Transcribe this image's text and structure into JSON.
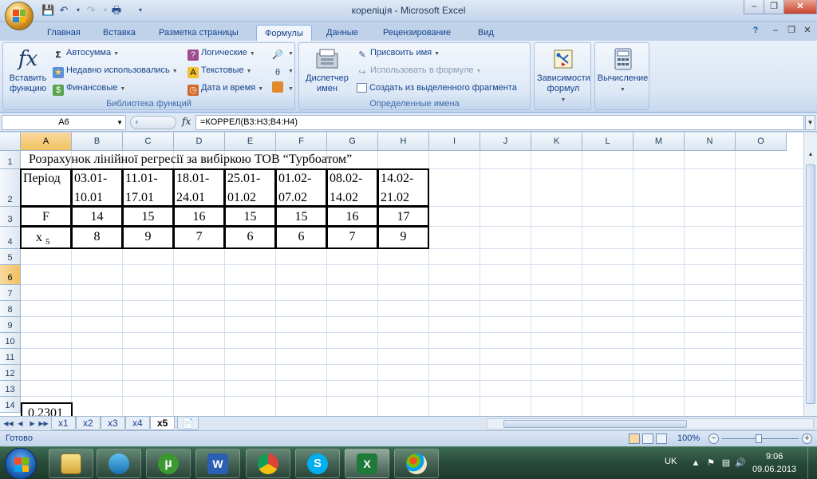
{
  "window": {
    "title": "кореліція - Microsoft Excel",
    "minimize": "–",
    "maximize": "❐",
    "close": "✕"
  },
  "ribbon_tabs": [
    "Главная",
    "Вставка",
    "Разметка страницы",
    "Формулы",
    "Данные",
    "Рецензирование",
    "Вид"
  ],
  "active_tab": "Формулы",
  "ribbon": {
    "function_library": {
      "label": "Библиотека функций",
      "insert_function": "Вставить функцию",
      "autosum": "Автосумма",
      "recently_used": "Недавно использовались",
      "financial": "Финансовые",
      "logical": "Логические",
      "text": "Текстовые",
      "date_time": "Дата и время"
    },
    "defined_names": {
      "label": "Определенные имена",
      "name_manager": "Диспетчер имен",
      "define_name": "Присвоить имя",
      "use_in_formula": "Использовать в формуле",
      "create_from_selection": "Создать из выделенного фрагмента"
    },
    "formula_auditing": {
      "label": "Зависимости формул"
    },
    "calculation": {
      "label": "Вычисление"
    }
  },
  "formula_bar": {
    "name_box": "A6",
    "fx": "fx",
    "formula": "=КОРРЕЛ(B3:H3;B4:H4)"
  },
  "columns": [
    "A",
    "B",
    "C",
    "D",
    "E",
    "F",
    "G",
    "H",
    "I",
    "J",
    "K",
    "L",
    "M",
    "N",
    "O"
  ],
  "rows": [
    "1",
    "2",
    "3",
    "4",
    "5",
    "6",
    "7",
    "8",
    "9",
    "10",
    "11",
    "12",
    "13",
    "14"
  ],
  "selected_cell": {
    "column": "A",
    "row": "6"
  },
  "sheet": {
    "title": "Розрахунок лінійної регресії за вибіркою ТОВ “Турбоатом”",
    "period_label": "Період",
    "periods": [
      {
        "start": "03.01-",
        "end": "10.01"
      },
      {
        "start": "11.01-",
        "end": "17.01"
      },
      {
        "start": "18.01-",
        "end": "24.01"
      },
      {
        "start": "25.01-",
        "end": "01.02"
      },
      {
        "start": "01.02-",
        "end": "07.02"
      },
      {
        "start": "08.02-",
        "end": "14.02"
      },
      {
        "start": "14.02-",
        "end": "21.02"
      }
    ],
    "f_label": "F",
    "f_values": [
      "14",
      "15",
      "16",
      "15",
      "15",
      "16",
      "17"
    ],
    "x_label": "x",
    "x_subscript": "5",
    "x_values": [
      "8",
      "9",
      "7",
      "6",
      "6",
      "7",
      "9"
    ],
    "result": "0,2301"
  },
  "sheet_tabs": [
    "x1",
    "x2",
    "x3",
    "x4",
    "x5"
  ],
  "active_sheet": "x5",
  "status": {
    "text": "Готово",
    "zoom": "100%"
  },
  "taskbar": {
    "lang": "UK",
    "time": "9:06",
    "date": "09.06.2013",
    "apps": [
      "explorer-icon",
      "media-player-icon",
      "utorrent-icon",
      "word-icon",
      "chrome-icon",
      "skype-icon",
      "excel-icon",
      "paint-icon"
    ],
    "active_app": "excel-icon"
  },
  "colors": {
    "ribbon_text": "#15428b",
    "selection_header": "#f1c15f",
    "taskbar": "#284a3a"
  }
}
